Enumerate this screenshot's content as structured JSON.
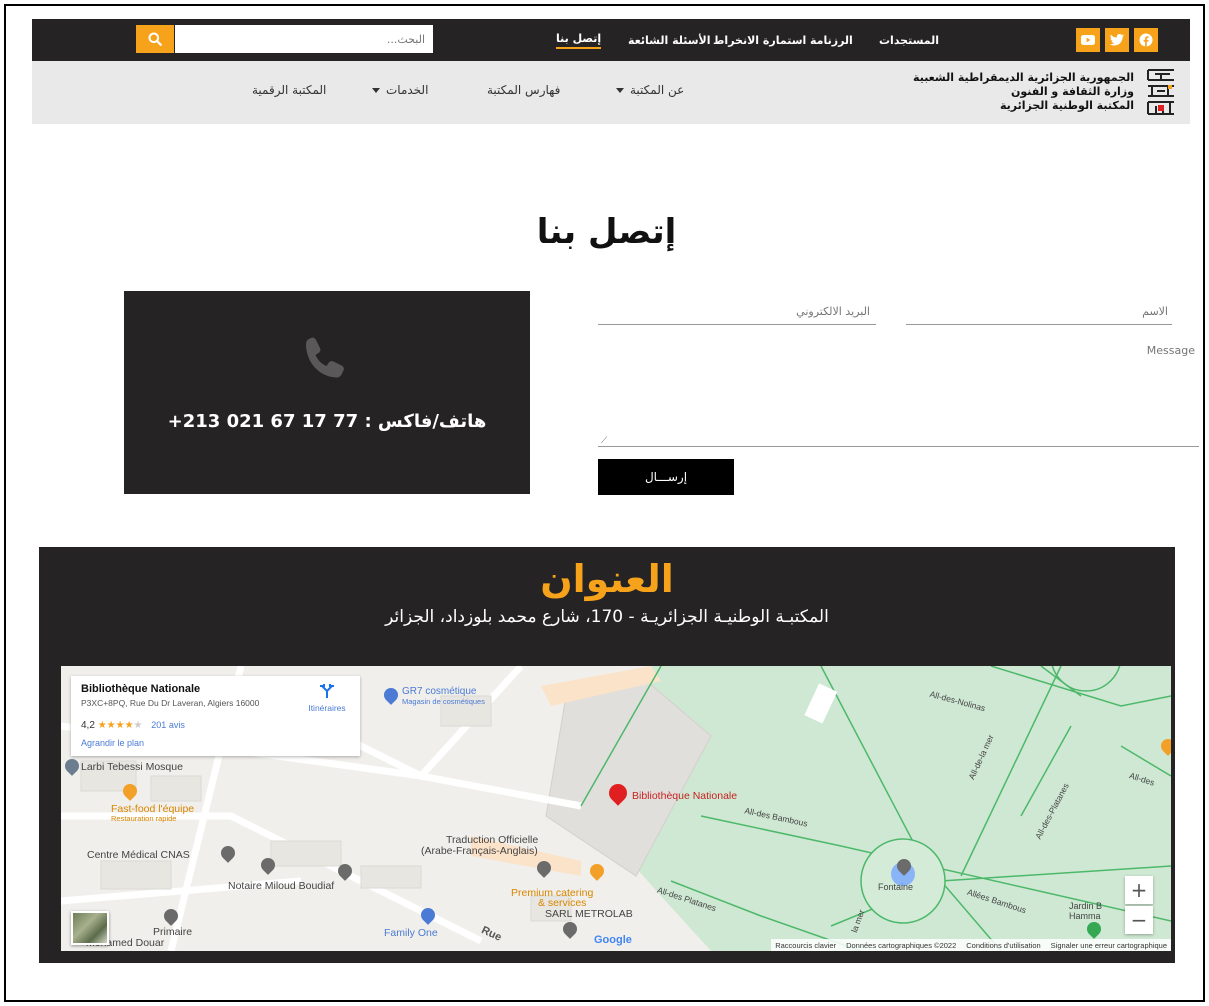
{
  "topbar": {
    "nav": [
      "المستجدات",
      "الرزنامة",
      "استمارة الانخراط",
      "الأسئلة الشائعة",
      "إتصل بنا"
    ],
    "active": "إتصل بنا",
    "search_placeholder": "البحث...",
    "accent": "#f7a21b"
  },
  "org": {
    "line1": "الجمهورية الجزائرية الديمقراطية الشعبية",
    "line2": "وزارة الثقافة و الفنون",
    "line3": "المكتبة الوطنية الجزائرية"
  },
  "subnav": {
    "about": "عن المكتبة",
    "catalogs": "فهارس المكتبة",
    "services": "الخدمات",
    "digital": "المكتبة الرقمية"
  },
  "page": {
    "title": "إتصل بنا"
  },
  "contact": {
    "phone": "هاتف/فاكس : 77 17 67 021 213+"
  },
  "form": {
    "name_placeholder": "الاسم",
    "email_placeholder": "البريد الالكتروني",
    "message_placeholder": "Message",
    "send_label": "إرســـال"
  },
  "address": {
    "title": "العنوان",
    "text": "المكتبـة الوطنيـة الجزائريـة - 170، شارع محمد بلوزداد، الجزائر"
  },
  "map": {
    "place_name": "Bibliothèque Nationale",
    "place_address": "P3XC+8PQ, Rue Du Dr Laveran, Algiers 16000",
    "rating": "4,2",
    "stars": 4.2,
    "reviews": "201 avis",
    "enlarge": "Agrandir le plan",
    "directions": "Itinéraires",
    "labels": {
      "gr7": "GR7 cosmétique",
      "gr7_sub": "Magasin de cosmétiques",
      "mosque": "Larbi Tebessi Mosque",
      "fastfood": "Fast-food l'équipe",
      "fastfood_sub": "Restauration rapide",
      "cnas": "Centre Médical CNAS",
      "notaire": "Notaire Miloud Boudiaf",
      "primaire": "Primaire",
      "douar": "Mohamed Douar",
      "traduction1": "Traduction Officielle",
      "traduction2": "(Arabe-Français-Anglais)",
      "premium1": "Premium catering",
      "premium2": "& services",
      "sarl": "SARL METROLAB",
      "family": "Family One",
      "biblio": "Bibliothèque Nationale",
      "bambous": "All-des Bambous",
      "bambous2": "Allées Bambous",
      "platanes": "All-des Platanes",
      "platanes2": "All-des-Platanes",
      "nolinas": "All-des-Nolinas",
      "delamer": "All-de-la mer",
      "lamer": "la mer",
      "alldes": "All-des",
      "fontaine": "Fontaine",
      "jardin1": "Jardin B",
      "jardin2": "Hamma",
      "rue": "Rue",
      "google": "Google"
    },
    "attribution": [
      "Raccourcis clavier",
      "Données cartographiques ©2022",
      "Conditions d'utilisation",
      "Signaler une erreur cartographique"
    ]
  }
}
